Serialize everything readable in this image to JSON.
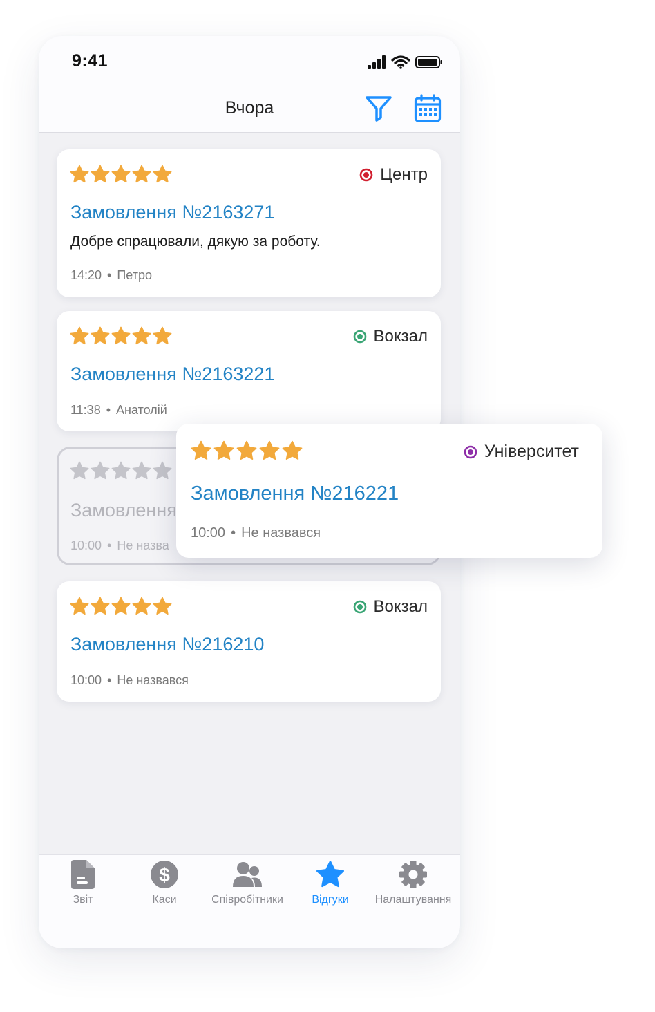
{
  "status_bar": {
    "time": "9:41"
  },
  "header": {
    "title": "Вчора"
  },
  "colors": {
    "accent": "#1e90ff",
    "star": "#f2a93b",
    "star_inactive": "#c4c4ca",
    "order_link": "#2383c5",
    "loc_center": "#d11f2f",
    "loc_station": "#3aa575",
    "loc_university": "#8e2ea8"
  },
  "reviews": [
    {
      "rating": 5,
      "location": "Центр",
      "order": "Замовлення №2163271",
      "comment": "Добре спрацювали, дякую за роботу.",
      "time": "14:20",
      "author": "Петро"
    },
    {
      "rating": 5,
      "location": "Вокзал",
      "order": "Замовлення №2163221",
      "time": "11:38",
      "author": "Анатолій"
    },
    {
      "rating": 5,
      "location": "",
      "order": "Замовлення",
      "time": "10:00",
      "author": "Не назва"
    },
    {
      "rating": 5,
      "location": "Вокзал",
      "order": "Замовлення №216210",
      "time": "10:00",
      "author": "Не назвався"
    }
  ],
  "dragged_review": {
    "rating": 5,
    "location": "Університет",
    "order": "Замовлення №216221",
    "time": "10:00",
    "author": "Не назвався"
  },
  "tabs": [
    {
      "label": "Звіт",
      "icon": "report-icon"
    },
    {
      "label": "Каси",
      "icon": "dollar-icon"
    },
    {
      "label": "Співробітники",
      "icon": "users-icon"
    },
    {
      "label": "Відгуки",
      "icon": "star-icon",
      "active": true
    },
    {
      "label": "Налаштування",
      "icon": "gear-icon"
    }
  ]
}
